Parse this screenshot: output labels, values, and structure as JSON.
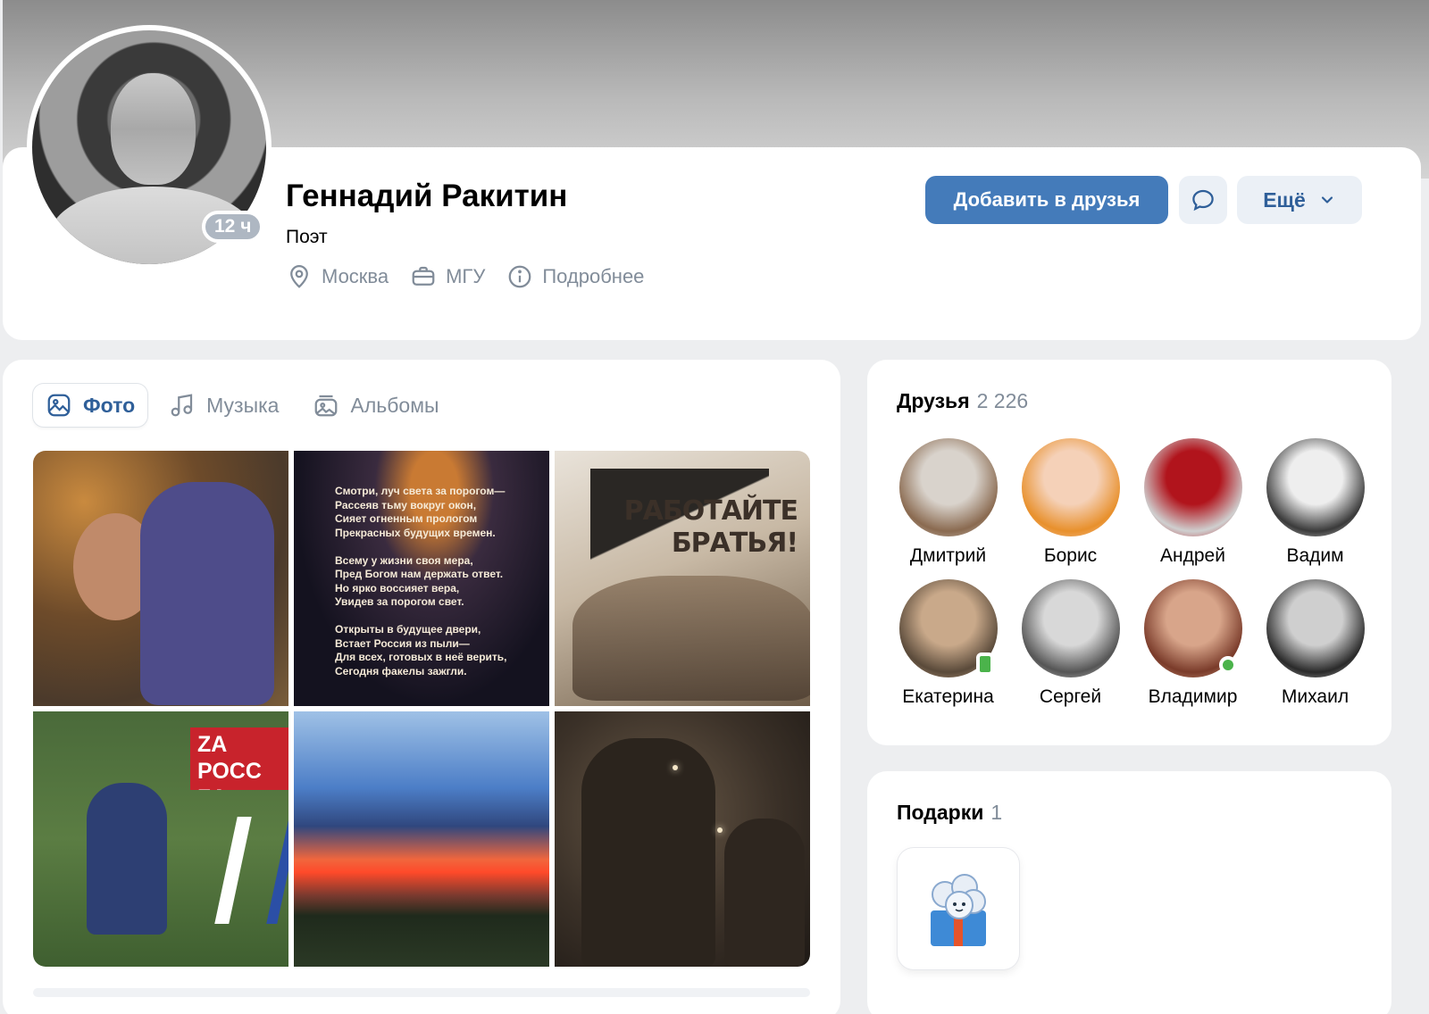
{
  "profile": {
    "name": "Геннадий Ракитин",
    "status": "Поэт",
    "last_seen": "12 ч",
    "info": [
      {
        "icon": "location-icon",
        "label": "Москва"
      },
      {
        "icon": "briefcase-icon",
        "label": "МГУ"
      },
      {
        "icon": "info-icon",
        "label": "Подробнее"
      }
    ],
    "actions": {
      "add_friend": "Добавить в друзья",
      "more": "Ещё"
    }
  },
  "photos": {
    "tabs": [
      {
        "icon": "photo-icon",
        "label": "Фото",
        "active": true
      },
      {
        "icon": "music-icon",
        "label": "Музыка",
        "active": false
      },
      {
        "icon": "albums-icon",
        "label": "Альбомы",
        "active": false
      }
    ],
    "poem_text": "Смотри, луч света за порогом—\nРассеяв тьму вокруг окон,\nСияет огненным прологом\nПрекрасных будущих времен.\n\nВсему у жизни своя мера,\nПред Богом нам держать ответ.\nНо ярко воссияет вера,\nУвидев за порогом свет.\n\nОткрыты в будущее двери,\nВстает Россия из пыли—\nДля всех, готовых в неё верить,\nСегодня факелы зажгли.",
    "poster_text": "РАБОТАЙТЕ\nБРАТЬЯ!",
    "banner_text": "ZA РОСС\nZA ПУТИ"
  },
  "friends": {
    "title": "Друзья",
    "count": "2 226",
    "items": [
      {
        "name": "Дмитрий",
        "colors": [
          "#d9d3cc",
          "#8a6a50"
        ],
        "online": ""
      },
      {
        "name": "Борис",
        "colors": [
          "#f5d1b8",
          "#e8902c"
        ],
        "online": ""
      },
      {
        "name": "Андрей",
        "colors": [
          "#b1141c",
          "#cfcfcf"
        ],
        "online": ""
      },
      {
        "name": "Вадим",
        "colors": [
          "#eeeeee",
          "#3a3a3a"
        ],
        "online": ""
      },
      {
        "name": "Екатерина",
        "colors": [
          "#c9a98a",
          "#5a4a3a"
        ],
        "online": "mobile"
      },
      {
        "name": "Сергей",
        "colors": [
          "#d8d8d8",
          "#555555"
        ],
        "online": ""
      },
      {
        "name": "Владимир",
        "colors": [
          "#d8a58a",
          "#7a3b2a"
        ],
        "online": "web"
      },
      {
        "name": "Михаил",
        "colors": [
          "#cfcfcf",
          "#2a2a2a"
        ],
        "online": ""
      }
    ]
  },
  "gifts": {
    "title": "Подарки",
    "count": "1"
  }
}
